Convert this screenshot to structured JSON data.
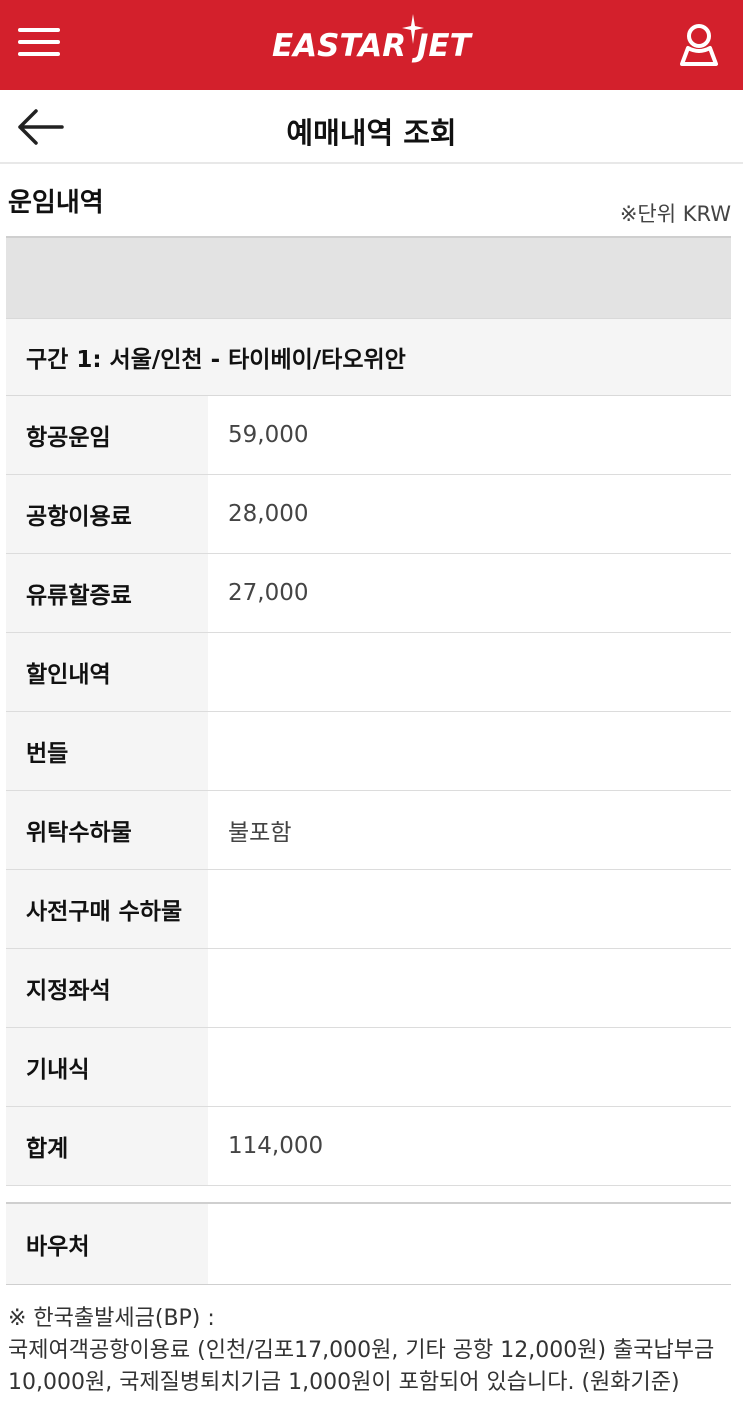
{
  "header": {
    "logo_text": "EASTAR JET",
    "menu_icon": "hamburger-menu-icon",
    "user_icon": "user-icon"
  },
  "subheader": {
    "back_icon": "arrow-left-icon",
    "title": "예매내역 조회"
  },
  "section": {
    "title": "운임내역",
    "unit_note": "※단위 KRW"
  },
  "segment": {
    "label": "구간 1: 서울/인천 - 타이베이/타오위안"
  },
  "fare_rows": [
    {
      "label": "항공운임",
      "value": "59,000"
    },
    {
      "label": "공항이용료",
      "value": "28,000"
    },
    {
      "label": "유류할증료",
      "value": "27,000"
    },
    {
      "label": "할인내역",
      "value": ""
    },
    {
      "label": "번들",
      "value": ""
    },
    {
      "label": "위탁수하물",
      "value": "불포함"
    },
    {
      "label": "사전구매 수하물",
      "value": ""
    },
    {
      "label": "지정좌석",
      "value": ""
    },
    {
      "label": "기내식",
      "value": ""
    },
    {
      "label": "합계",
      "value": "114,000"
    }
  ],
  "voucher": {
    "label": "바우처",
    "value": ""
  },
  "footnote": {
    "line1": "※ 한국출발세금(BP) :",
    "line2": "국제여객공항이용료 (인천/김포17,000원, 기타 공항 12,000원) 출국납부금",
    "line3": "10,000원, 국제질병퇴치기금 1,000원이 포함되어 있습니다. (원화기준)"
  },
  "colors": {
    "brand_red": "#d3202c",
    "label_bg": "#f5f5f5",
    "band_gray": "#e3e3e3"
  }
}
